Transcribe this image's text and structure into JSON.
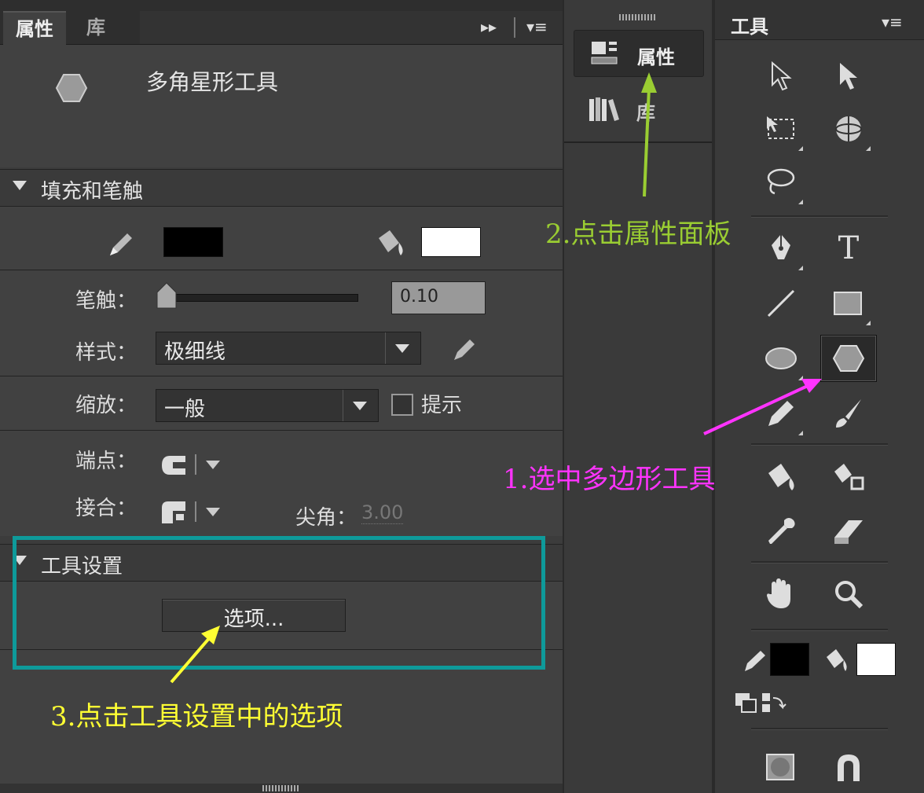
{
  "left_panel": {
    "tabs": [
      {
        "label": "属性"
      },
      {
        "label": "库"
      }
    ],
    "tool_name": "多角星形工具",
    "sections": {
      "fill_stroke": "填充和笔触",
      "tool_settings": "工具设置"
    },
    "stroke_label": "笔触：",
    "stroke_value": "0.10",
    "stroke_slider_fraction": 0.0,
    "style_label": "样式：",
    "style_value": "极细线",
    "scale_label": "缩放：",
    "scale_value": "一般",
    "hint_label": "提示",
    "cap_label": "端点：",
    "join_label": "接合：",
    "miter_label": "尖角：",
    "miter_value": "3.00",
    "options_button": "选项..."
  },
  "middle_panel": {
    "items": [
      {
        "label": "属性"
      },
      {
        "label": "库"
      }
    ]
  },
  "tools_panel": {
    "title": "工具",
    "text_tool_glyph": "T"
  },
  "colors": {
    "stroke_color": "#000000",
    "fill_color": "#ffffff",
    "annot_green": "#9acd32",
    "annot_magenta": "#ff33ff",
    "annot_yellow": "#ffff33",
    "highlight_box": "#0e9a9a"
  },
  "annotations": {
    "step1": "1.选中多边形工具",
    "step2": "2.点击属性面板",
    "step3": "3.点击工具设置中的选项"
  }
}
